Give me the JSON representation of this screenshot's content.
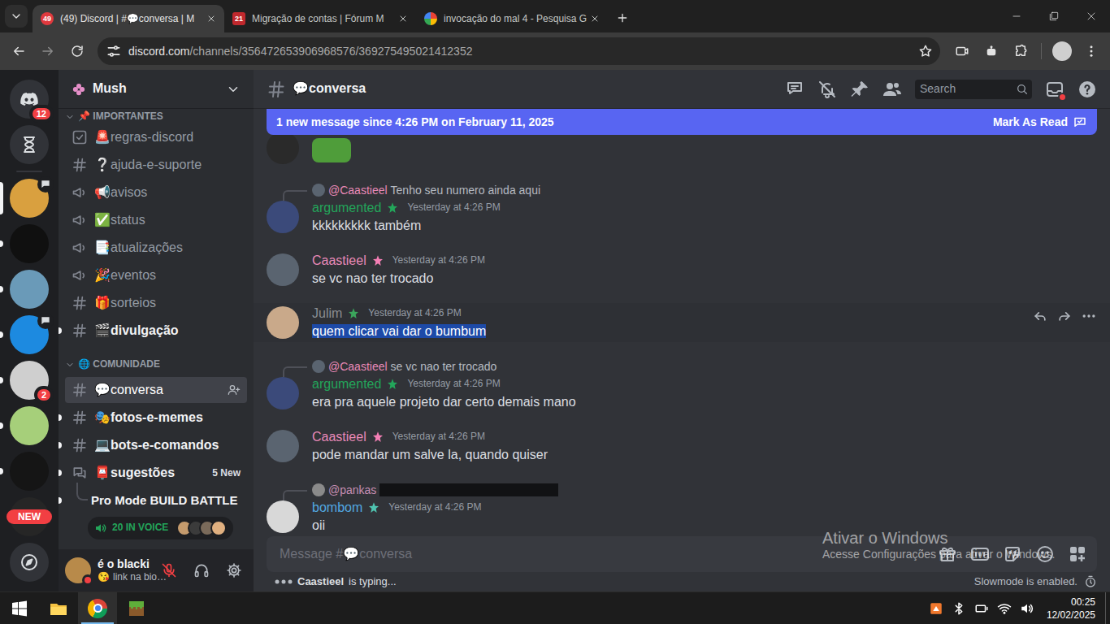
{
  "browser": {
    "tabs": [
      {
        "kind": "discord",
        "favicon_badge": "49",
        "label": "(49) Discord | #💬conversa | M",
        "selected": true
      },
      {
        "kind": "forum",
        "favicon_badge": "21",
        "label": "Migração de contas | Fórum M",
        "selected": false
      },
      {
        "kind": "google",
        "label": "invocação do mal 4 - Pesquisa G",
        "selected": false
      }
    ],
    "url": {
      "host": "discord.com",
      "path": "/channels/356472653906968576/369275495021412352"
    },
    "bookmarked": false
  },
  "servers": [
    {
      "kind": "home",
      "color": "#313338",
      "badge": "12",
      "selected": false,
      "unread": false,
      "activity": false
    },
    {
      "kind": "hourglass",
      "color": "#313338",
      "selected": false,
      "unread": false,
      "activity": false
    },
    {
      "kind": "server",
      "color": "#d9a03f",
      "selected": true,
      "unread": false,
      "activity": true
    },
    {
      "kind": "server",
      "color": "#101010",
      "selected": false,
      "unread": true,
      "activity": false
    },
    {
      "kind": "server",
      "color": "#6a9ab8",
      "selected": false,
      "unread": true,
      "activity": false
    },
    {
      "kind": "server",
      "color": "#1d8ae0",
      "selected": false,
      "unread": true,
      "activity": true
    },
    {
      "kind": "server",
      "color": "#cfcfcf",
      "badge": "2",
      "selected": false,
      "unread": true,
      "activity": false
    },
    {
      "kind": "server",
      "color": "#a6cf7a",
      "selected": false,
      "unread": true,
      "activity": false
    },
    {
      "kind": "server",
      "color": "#151515",
      "selected": false,
      "unread": true,
      "activity": false
    },
    {
      "kind": "server",
      "color": "#262626",
      "new_label": "NEW",
      "selected": false,
      "unread": false,
      "activity": false
    },
    {
      "kind": "discover",
      "color": "#313338",
      "selected": false,
      "unread": false,
      "activity": false
    }
  ],
  "guild": {
    "name": "Mush",
    "categories": [
      {
        "label": "📌 IMPORTANTES",
        "channels": [
          {
            "kind": "rules",
            "name": "🚨regras-discord",
            "unread": false,
            "selected": false
          },
          {
            "kind": "text",
            "name": "❔ajuda-e-suporte",
            "unread": false,
            "selected": false
          },
          {
            "kind": "announce",
            "name": "📢avisos",
            "unread": false,
            "selected": false
          },
          {
            "kind": "announce",
            "name": "✅status",
            "unread": false,
            "selected": false
          },
          {
            "kind": "announce",
            "name": "📑atualizações",
            "unread": false,
            "selected": false
          },
          {
            "kind": "announce",
            "name": "🎉eventos",
            "unread": false,
            "selected": false
          },
          {
            "kind": "text",
            "name": "🎁sorteios",
            "unread": false,
            "selected": false
          },
          {
            "kind": "text",
            "name": "🎬divulgação",
            "unread": true,
            "selected": false
          }
        ]
      },
      {
        "label": "🌐 COMUNIDADE",
        "channels": [
          {
            "kind": "text",
            "name": "💬conversa",
            "unread": false,
            "selected": true
          },
          {
            "kind": "text",
            "name": "🎭fotos-e-memes",
            "unread": true,
            "selected": false
          },
          {
            "kind": "text",
            "name": "💻bots-e-comandos",
            "unread": true,
            "selected": false
          },
          {
            "kind": "forum",
            "name": "📮sugestões",
            "unread": true,
            "selected": false,
            "badge": "5 New"
          }
        ]
      }
    ],
    "thread": {
      "name": "Pro Mode BUILD BATTLE",
      "unread": true
    },
    "voice": {
      "label": "20 IN VOICE",
      "avatars": [
        "#c59b6d",
        "#3b3b3b",
        "#7a6a5a",
        "#e0b080"
      ]
    }
  },
  "user": {
    "name": "é o blacki",
    "status_emoji": "😘",
    "status": "link na bio…",
    "avatar_color": "#b88a4a",
    "presence": "dnd",
    "mic_muted": true
  },
  "chat": {
    "channel": "💬conversa",
    "search_placeholder": "Search",
    "inbox_unread": true,
    "new_bar": {
      "text": "1 new message since 4:26 PM on February 11, 2025",
      "action": "Mark As Read"
    },
    "messages": [
      {
        "kind": "sticker",
        "avatar_color": "#2a2a2a",
        "sticker_color": "#4f9d3a"
      },
      {
        "kind": "message",
        "reply": {
          "author": "@Caastieel",
          "author_color": "#e889b7",
          "avatar_color": "#5a6470",
          "text": "Tenho seu numero ainda aqui",
          "redacted": false
        },
        "author": "argumented",
        "color": "#23a55a",
        "role_color": "#23a55a",
        "avatar_color": "#3b4a7a",
        "time": "Yesterday at 4:26 PM",
        "text": "kkkkkkkkk também",
        "hovered": false,
        "text_selected": false
      },
      {
        "kind": "message",
        "reply": null,
        "author": "Caastieel",
        "color": "#e889b7",
        "role_color": "#f47fb5",
        "avatar_color": "#5a6470",
        "time": "Yesterday at 4:26 PM",
        "text": "se vc nao ter trocado",
        "hovered": false,
        "text_selected": false
      },
      {
        "kind": "message",
        "reply": null,
        "author": "Julim",
        "color": "#8a8e93",
        "role_color": "#3ba55c",
        "avatar_color": "#c9a98a",
        "time": "Yesterday at 4:26 PM",
        "text": "quem clicar vai dar o bumbum",
        "hovered": true,
        "text_selected": true
      },
      {
        "kind": "message",
        "reply": {
          "author": "@Caastieel",
          "author_color": "#e889b7",
          "avatar_color": "#5a6470",
          "text": "se vc nao ter trocado",
          "redacted": false
        },
        "author": "argumented",
        "color": "#23a55a",
        "role_color": "#23a55a",
        "avatar_color": "#3b4a7a",
        "time": "Yesterday at 4:26 PM",
        "text": "era pra aquele projeto dar certo demais mano",
        "hovered": false,
        "text_selected": false
      },
      {
        "kind": "message",
        "reply": null,
        "author": "Caastieel",
        "color": "#e889b7",
        "role_color": "#f47fb5",
        "avatar_color": "#5a6470",
        "time": "Yesterday at 4:26 PM",
        "text": "pode mandar um salve la, quando quiser",
        "hovered": false,
        "text_selected": false
      },
      {
        "kind": "message",
        "reply": {
          "author": "@pankas",
          "author_color": "#c78fb4",
          "avatar_color": "#8a8a8a",
          "redacted": true
        },
        "author": "bombom",
        "color": "#52a8e0",
        "role_color": "#4fc3b0",
        "avatar_color": "#d8d8d8",
        "time": "Yesterday at 4:26 PM",
        "text": "oii",
        "hovered": false,
        "text_selected": false
      }
    ],
    "composer_placeholder": "Message #💬conversa",
    "typing_user": "Caastieel",
    "typing_text": "is typing...",
    "slowmode": "Slowmode is enabled."
  },
  "watermark": {
    "title": "Ativar o Windows",
    "text": "Acesse Configurações para ativar o Windows."
  },
  "taskbar": {
    "apps": [
      {
        "kind": "start",
        "selected": false
      },
      {
        "kind": "explorer",
        "selected": false
      },
      {
        "kind": "chrome",
        "selected": true
      },
      {
        "kind": "minecraft",
        "selected": false
      }
    ],
    "tray": [
      "app",
      "bluetooth",
      "device",
      "wifi",
      "volume"
    ],
    "time": "00:25",
    "date": "12/02/2025"
  }
}
